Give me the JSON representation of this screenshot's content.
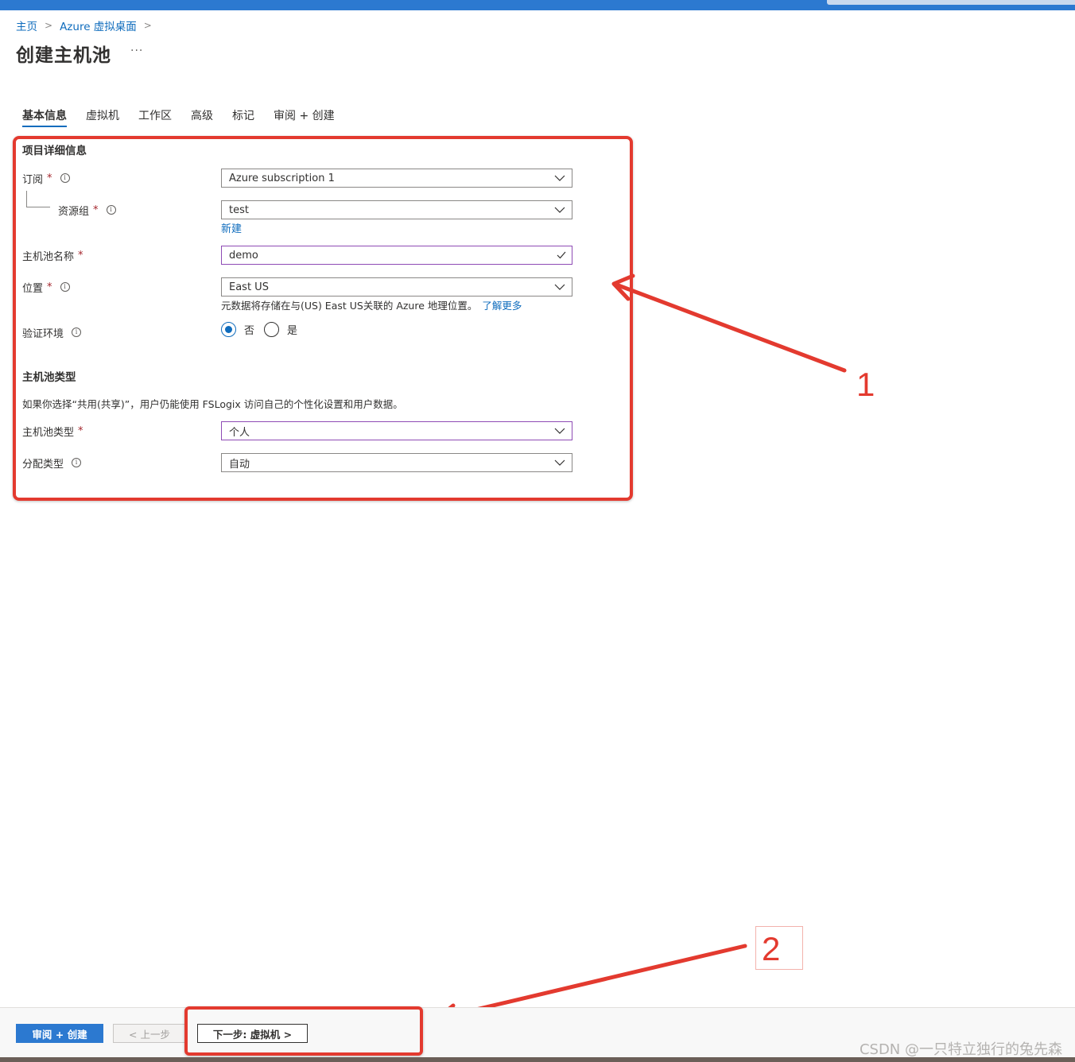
{
  "breadcrumb": {
    "home": "主页",
    "parent": "Azure 虚拟桌面",
    "sep": ">"
  },
  "page": {
    "title": "创建主机池",
    "more": "···"
  },
  "tabs": [
    {
      "label": "基本信息",
      "active": true
    },
    {
      "label": "虚拟机"
    },
    {
      "label": "工作区"
    },
    {
      "label": "高级"
    },
    {
      "label": "标记"
    },
    {
      "label": "审阅 + 创建"
    }
  ],
  "project": {
    "title": "项目详细信息",
    "subscription": {
      "label": "订阅",
      "required": "*",
      "value": "Azure subscription 1"
    },
    "resource_group": {
      "label": "资源组",
      "required": "*",
      "value": "test",
      "new_link": "新建"
    },
    "hostpool_name": {
      "label": "主机池名称",
      "required": "*",
      "value": "demo"
    },
    "location": {
      "label": "位置",
      "required": "*",
      "value": "East US",
      "help": "元数据将存储在与(US) East US关联的 Azure 地理位置。",
      "learn_more": "了解更多"
    },
    "validation": {
      "label": "验证环境",
      "option_no": "否",
      "option_yes": "是",
      "selected": "否"
    }
  },
  "hostpool_type": {
    "title": "主机池类型",
    "description": "如果你选择“共用(共享)”，用户仍能使用 FSLogix 访问自己的个性化设置和用户数据。",
    "type": {
      "label": "主机池类型",
      "required": "*",
      "value": "个人"
    },
    "assignment": {
      "label": "分配类型",
      "value": "自动"
    }
  },
  "info_glyph": "i",
  "annotations": {
    "one": "1",
    "two": "2"
  },
  "footer": {
    "review_create": "审阅 + 创建",
    "previous": "< 上一步",
    "next": "下一步: 虚拟机 >"
  },
  "watermark": "CSDN @一只特立独行的兔先森",
  "colors": {
    "accent": "#0f6cbd",
    "primary_button": "#2c79d0",
    "annotation": "#e33a2f",
    "focus": "#8e4bb5"
  }
}
